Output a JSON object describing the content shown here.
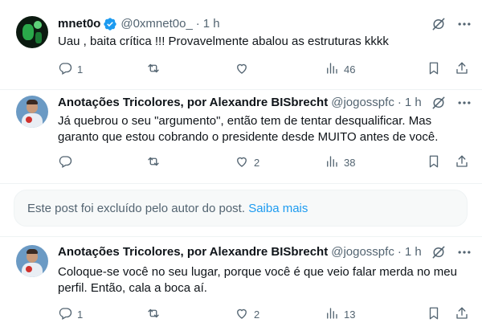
{
  "posts": [
    {
      "name": "mnet0o",
      "verified": true,
      "handle": "@0xmnet0o_",
      "separator": "·",
      "time": "1 h",
      "text": "Uau , baita crítica !!! Provavelmente abalou as estruturas kkkk",
      "actions": {
        "replies": "1",
        "reposts": "",
        "likes": "",
        "views": "46"
      }
    },
    {
      "name": "Anotações Tricolores, por Alexandre BISbrecht",
      "verified": false,
      "handle": "@jogosspfc",
      "separator": "·",
      "time": "1 h",
      "text": "Já quebrou o seu \"argumento\", então tem de tentar desqualificar. Mas garanto que estou cobrando o presidente desde MUITO antes de você.",
      "actions": {
        "replies": "",
        "reposts": "",
        "likes": "2",
        "views": "38"
      }
    },
    {
      "name": "Anotações Tricolores, por Alexandre BISbrecht",
      "verified": false,
      "handle": "@jogosspfc",
      "separator": "·",
      "time": "1 h",
      "text": "Coloque-se você no seu lugar, porque você é que veio falar merda no meu perfil. Então, cala a boca aí.",
      "actions": {
        "replies": "1",
        "reposts": "",
        "likes": "2",
        "views": "13"
      }
    }
  ],
  "deleted_notice": {
    "text": "Este post foi excluído pelo autor do post.",
    "link": "Saiba mais"
  },
  "icons": {
    "verified": "verified-badge-icon",
    "grok": "grok-icon",
    "more": "more-dots-icon",
    "reply": "reply-icon",
    "repost": "repost-icon",
    "like": "like-icon",
    "views": "views-icon",
    "bookmark": "bookmark-icon",
    "share": "share-icon"
  },
  "colors": {
    "text": "#0f1419",
    "secondary": "#536471",
    "accent": "#1d9bf0",
    "divider": "#eff3f4"
  }
}
